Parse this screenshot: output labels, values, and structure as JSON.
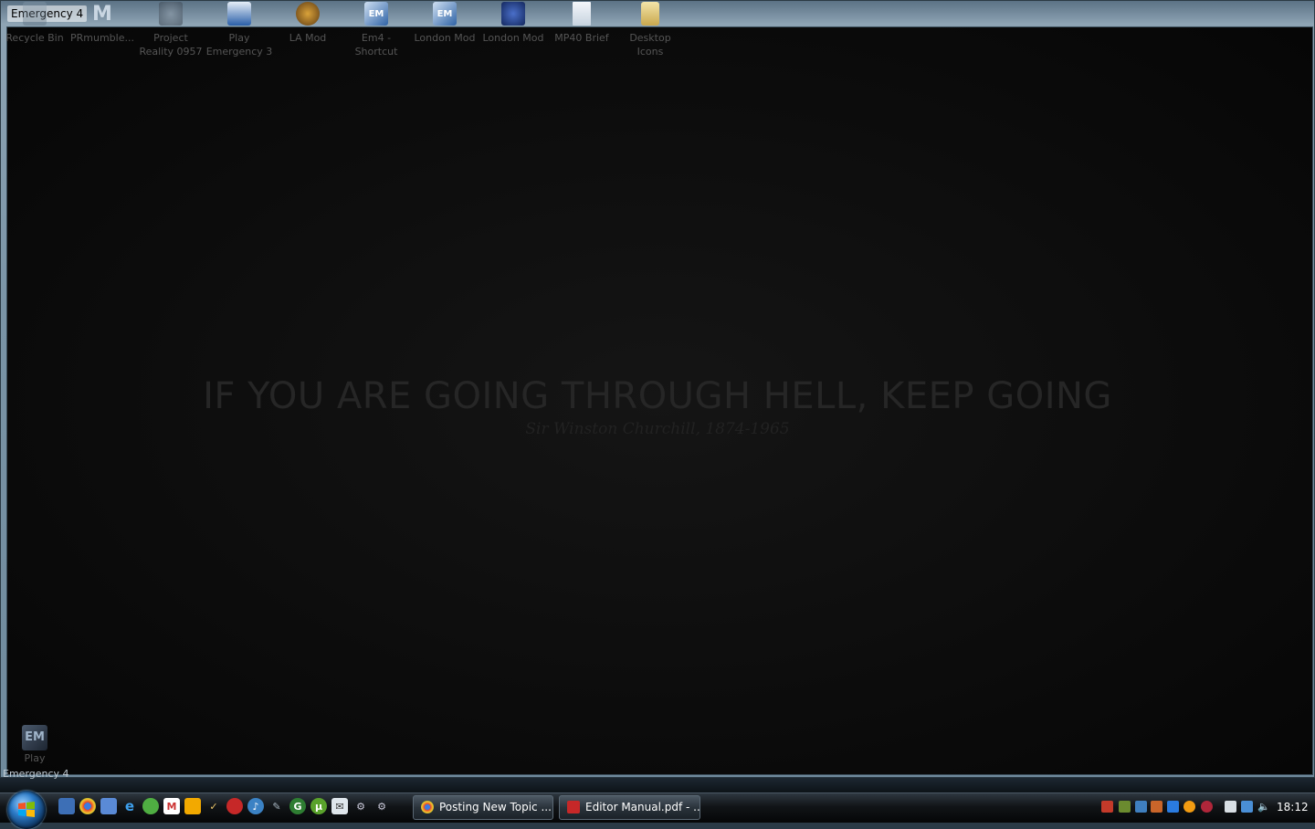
{
  "window": {
    "title": "Emergency 4"
  },
  "wallpaper": {
    "quote": "IF YOU ARE GOING THROUGH HELL, KEEP GOING",
    "attribution": "Sir Winston Churchill, 1874-1965"
  },
  "desktop_icons": [
    {
      "label": "Recycle Bin",
      "icon": "recycle-bin-icon"
    },
    {
      "label": "PRmumble...",
      "icon": "mumble-icon"
    },
    {
      "label": "Project Reality 0957",
      "icon": "project-reality-icon"
    },
    {
      "label": "Play Emergency 3",
      "icon": "emergency3-icon"
    },
    {
      "label": "LA Mod",
      "icon": "la-mod-icon"
    },
    {
      "label": "Em4 - Shortcut",
      "icon": "em4-shortcut-icon"
    },
    {
      "label": "London Mod",
      "icon": "london-mod-icon"
    },
    {
      "label": "London Mod",
      "icon": "london-mod-icon"
    },
    {
      "label": "MP40 Brief",
      "icon": "text-document-icon"
    },
    {
      "label": "Desktop Icons",
      "icon": "folder-icon"
    }
  ],
  "bottom_desktop_icon": {
    "label": "Play",
    "icon": "play-shortcut-icon"
  },
  "desktop_caption": "Emergency 4",
  "taskbar": {
    "tasks": [
      {
        "label": "Posting New Topic ...",
        "icon": "chrome-icon"
      },
      {
        "label": "Editor Manual.pdf - ...",
        "icon": "pdf-icon"
      }
    ],
    "clock": "18:12"
  }
}
